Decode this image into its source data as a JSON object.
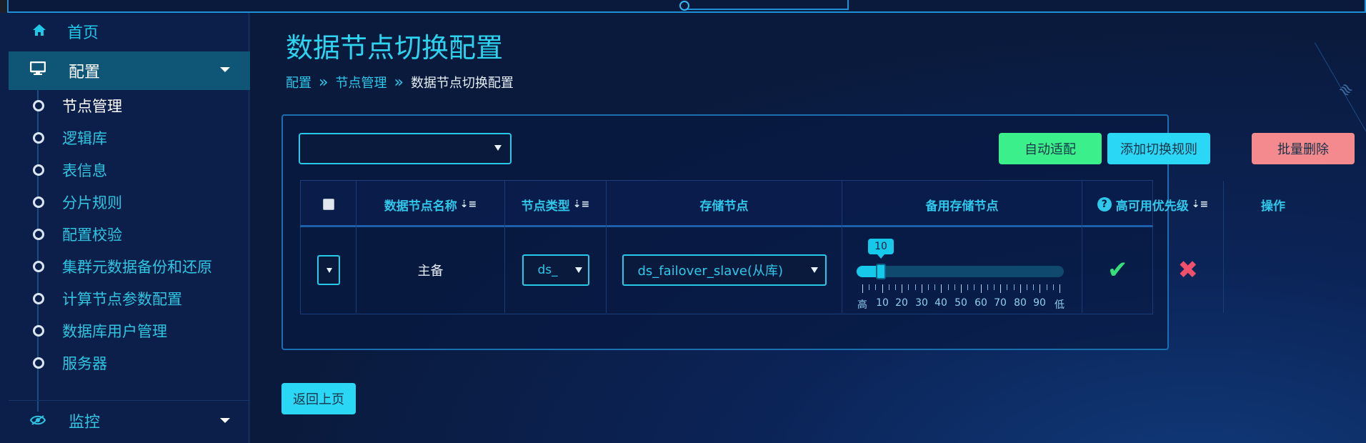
{
  "sidebar": {
    "home": {
      "label": "首页",
      "icon": "home-icon"
    },
    "config": {
      "label": "配置",
      "icon": "monitor-icon",
      "expanded": true
    },
    "config_items": [
      {
        "label": "节点管理",
        "active": true
      },
      {
        "label": "逻辑库"
      },
      {
        "label": "表信息"
      },
      {
        "label": "分片规则"
      },
      {
        "label": "配置校验"
      },
      {
        "label": "集群元数据备份和还原"
      },
      {
        "label": "计算节点参数配置"
      },
      {
        "label": "数据库用户管理"
      },
      {
        "label": "服务器"
      }
    ],
    "monitor": {
      "label": "监控",
      "icon": "eye-icon"
    }
  },
  "page": {
    "title": "数据节点切换配置",
    "breadcrumb": [
      "配置",
      "节点管理",
      "数据节点切换配置"
    ],
    "breadcrumb_separator": "»"
  },
  "toolbar": {
    "filter_select_value": "",
    "auto_adapt_label": "自动适配",
    "add_rule_label": "添加切换规则",
    "batch_delete_label": "批量删除"
  },
  "table": {
    "headers": {
      "name": "数据节点名称",
      "type": "节点类型",
      "storage": "存储节点",
      "backup_storage": "备用存储节点",
      "priority": "高可用优先级",
      "actions": "操作"
    },
    "rows": [
      {
        "name": "主备",
        "type_value": "ds_",
        "storage_value": "ds_failover_slave(从库)",
        "priority_value": "10",
        "priority_fraction": 0.1,
        "scale_labels": [
          "高",
          "10",
          "20",
          "30",
          "40",
          "50",
          "60",
          "70",
          "80",
          "90",
          "低"
        ],
        "confirm_icon": "check-icon",
        "cancel_icon": "close-icon"
      }
    ]
  },
  "footer": {
    "back_label": "返回上页"
  },
  "colors": {
    "accent": "#2cd4f0",
    "btn_green": "#3bf08a",
    "btn_cyan": "#2ad8f5",
    "btn_red": "#f58a8e",
    "check": "#36e078",
    "cross": "#f0506a"
  }
}
